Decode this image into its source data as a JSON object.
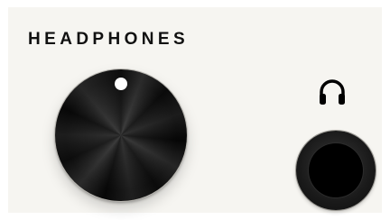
{
  "panel": {
    "title": "HEADPHONES"
  },
  "controls": {
    "volume_knob": "headphone-volume-knob",
    "output_jack": "headphone-output-jack"
  },
  "icons": {
    "headphones": "headphones-icon"
  },
  "colors": {
    "panel_background": "#f6f5f1",
    "text": "#111111",
    "knob": "#141414",
    "indicator": "#ffffff",
    "jack": "#000000"
  }
}
